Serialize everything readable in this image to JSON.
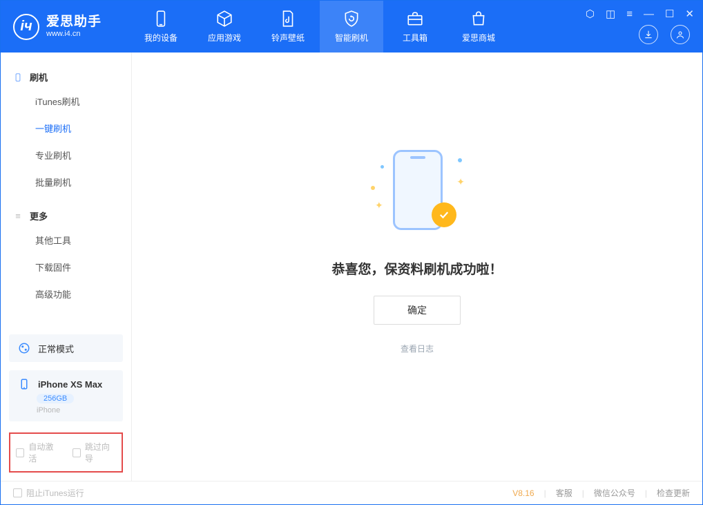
{
  "brand": {
    "name": "爱思助手",
    "url": "www.i4.cn"
  },
  "nav": {
    "my_device": "我的设备",
    "apps_games": "应用游戏",
    "ring_wall": "铃声壁纸",
    "smart_flash": "智能刷机",
    "toolbox": "工具箱",
    "store": "爱思商城"
  },
  "sidebar": {
    "group_flash": "刷机",
    "items_flash": {
      "itunes": "iTunes刷机",
      "oneclick": "一键刷机",
      "pro": "专业刷机",
      "batch": "批量刷机"
    },
    "group_more": "更多",
    "items_more": {
      "other": "其他工具",
      "firmware": "下载固件",
      "advanced": "高级功能"
    }
  },
  "mode_card": {
    "label": "正常模式"
  },
  "device_card": {
    "name": "iPhone XS Max",
    "storage": "256GB",
    "type": "iPhone"
  },
  "options": {
    "auto_activate": "自动激活",
    "skip_guide": "跳过向导"
  },
  "main": {
    "success_text": "恭喜您，保资料刷机成功啦！",
    "ok_button": "确定",
    "view_log": "查看日志"
  },
  "statusbar": {
    "block_itunes": "阻止iTunes运行",
    "version": "V8.16",
    "support": "客服",
    "wechat": "微信公众号",
    "check_update": "检查更新"
  }
}
